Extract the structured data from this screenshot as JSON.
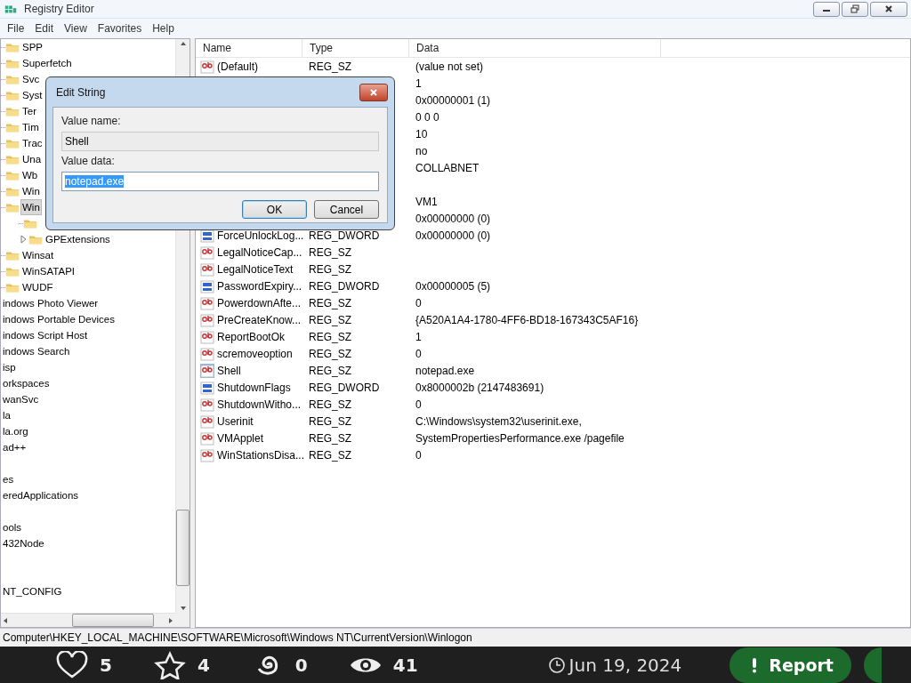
{
  "window": {
    "title": "Registry Editor"
  },
  "menu": [
    "File",
    "Edit",
    "View",
    "Favorites",
    "Help"
  ],
  "tree": {
    "items": [
      {
        "kind": "folder",
        "label": "SPP",
        "selected": false
      },
      {
        "kind": "folder",
        "label": "Superfetch",
        "selected": false
      },
      {
        "kind": "folder",
        "label": "Svc",
        "selected": false
      },
      {
        "kind": "folder",
        "label": "Syst",
        "selected": false
      },
      {
        "kind": "folder",
        "label": "Ter",
        "selected": false
      },
      {
        "kind": "folder",
        "label": "Tim",
        "selected": false
      },
      {
        "kind": "folder",
        "label": "Trac",
        "selected": false
      },
      {
        "kind": "folder",
        "label": "Una",
        "selected": false
      },
      {
        "kind": "folder",
        "label": "Wb",
        "selected": false
      },
      {
        "kind": "folder",
        "label": "Win",
        "selected": false
      },
      {
        "kind": "folder",
        "label": "Win",
        "selected": true,
        "children": [
          {
            "kind": "folder"
          },
          {
            "kind": "folder",
            "label": "GPExtensions",
            "selected": false,
            "expanded": false
          }
        ]
      },
      {
        "kind": "folder",
        "label": "Winsat",
        "selected": false
      },
      {
        "kind": "folder",
        "label": "WinSATAPI",
        "selected": false
      },
      {
        "kind": "folder",
        "label": "WUDF",
        "selected": false
      },
      {
        "kind": "cut",
        "label": "indows Photo Viewer",
        "selected": false
      },
      {
        "kind": "cut",
        "label": "indows Portable Devices",
        "selected": false
      },
      {
        "kind": "cut",
        "label": "indows Script Host",
        "selected": false
      },
      {
        "kind": "cut",
        "label": "indows Search",
        "selected": false
      },
      {
        "kind": "cut",
        "label": "isp",
        "selected": false
      },
      {
        "kind": "cut",
        "label": "orkspaces",
        "selected": false
      },
      {
        "kind": "cut",
        "label": "wanSvc",
        "selected": false
      },
      {
        "kind": "cut",
        "label": "la",
        "selected": false
      },
      {
        "kind": "cut",
        "label": "la.org",
        "selected": false
      },
      {
        "kind": "cut",
        "label": "ad++",
        "selected": false
      },
      {
        "kind": "blank"
      },
      {
        "kind": "cut",
        "label": "es",
        "selected": false
      },
      {
        "kind": "cut",
        "label": "eredApplications",
        "selected": false
      },
      {
        "kind": "blank"
      },
      {
        "kind": "cut",
        "label": "ools",
        "selected": false
      },
      {
        "kind": "cut",
        "label": "432Node",
        "selected": false
      },
      {
        "kind": "blank"
      },
      {
        "kind": "blank"
      },
      {
        "kind": "cut",
        "label": "NT_CONFIG",
        "selected": false
      }
    ]
  },
  "list": {
    "columns": [
      "Name",
      "Type",
      "Data"
    ],
    "rows": [
      {
        "kind": "string",
        "name": "(Default)",
        "type": "REG_SZ",
        "data": "(value not set)",
        "selected": false
      },
      {
        "kind": "hidden",
        "data": "1"
      },
      {
        "kind": "hidden",
        "data": "0x00000001 (1)"
      },
      {
        "kind": "hidden",
        "data": "0 0 0"
      },
      {
        "kind": "hidden",
        "data": "10"
      },
      {
        "kind": "hidden",
        "data": "no"
      },
      {
        "kind": "hidden",
        "data": "COLLABNET"
      },
      {
        "kind": "hidden"
      },
      {
        "kind": "hidden",
        "data": "VM1"
      },
      {
        "kind": "hidden",
        "data": "0x00000000 (0)"
      },
      {
        "kind": "dword",
        "name": "ForceUnlockLog...",
        "type": "REG_DWORD",
        "data": "0x00000000 (0)",
        "selected": false
      },
      {
        "kind": "string",
        "name": "LegalNoticeCap...",
        "type": "REG_SZ",
        "selected": false
      },
      {
        "kind": "string",
        "name": "LegalNoticeText",
        "type": "REG_SZ",
        "selected": false
      },
      {
        "kind": "dword",
        "name": "PasswordExpiry...",
        "type": "REG_DWORD",
        "data": "0x00000005 (5)",
        "selected": false
      },
      {
        "kind": "string",
        "name": "PowerdownAfte...",
        "type": "REG_SZ",
        "data": "0",
        "selected": false
      },
      {
        "kind": "string",
        "name": "PreCreateKnow...",
        "type": "REG_SZ",
        "data": "{A520A1A4-1780-4FF6-BD18-167343C5AF16}",
        "selected": false
      },
      {
        "kind": "string",
        "name": "ReportBootOk",
        "type": "REG_SZ",
        "data": "1",
        "selected": false
      },
      {
        "kind": "string",
        "name": "scremoveoption",
        "type": "REG_SZ",
        "data": "0",
        "selected": false
      },
      {
        "kind": "string",
        "name": "Shell",
        "type": "REG_SZ",
        "data": "notepad.exe",
        "selected": true
      },
      {
        "kind": "dword",
        "name": "ShutdownFlags",
        "type": "REG_DWORD",
        "data": "0x8000002b (2147483691)",
        "selected": false
      },
      {
        "kind": "string",
        "name": "ShutdownWitho...",
        "type": "REG_SZ",
        "data": "0",
        "selected": false
      },
      {
        "kind": "string",
        "name": "Userinit",
        "type": "REG_SZ",
        "data": "C:\\Windows\\system32\\userinit.exe,",
        "selected": false
      },
      {
        "kind": "string",
        "name": "VMApplet",
        "type": "REG_SZ",
        "data": "SystemPropertiesPerformance.exe /pagefile",
        "selected": false
      },
      {
        "kind": "string",
        "name": "WinStationsDisa...",
        "type": "REG_SZ",
        "data": "0",
        "selected": false
      }
    ]
  },
  "dialog": {
    "title": "Edit String",
    "name_label": "Value name:",
    "name_value": "Shell",
    "data_label": "Value data:",
    "data_value": "notepad.exe",
    "data_value_selected": true,
    "buttons": [
      {
        "label": "OK",
        "default": true
      },
      {
        "label": "Cancel",
        "default": false
      }
    ]
  },
  "status_bar": "Computer\\HKEY_LOCAL_MACHINE\\SOFTWARE\\Microsoft\\Windows NT\\CurrentVersion\\Winlogon",
  "footer": {
    "stats": [
      {
        "kind": "likes",
        "count": "5"
      },
      {
        "kind": "stars",
        "count": "4"
      },
      {
        "kind": "spiral",
        "count": "0"
      },
      {
        "kind": "views",
        "count": "41"
      }
    ],
    "date": "Jun 19, 2024",
    "report": "Report"
  }
}
